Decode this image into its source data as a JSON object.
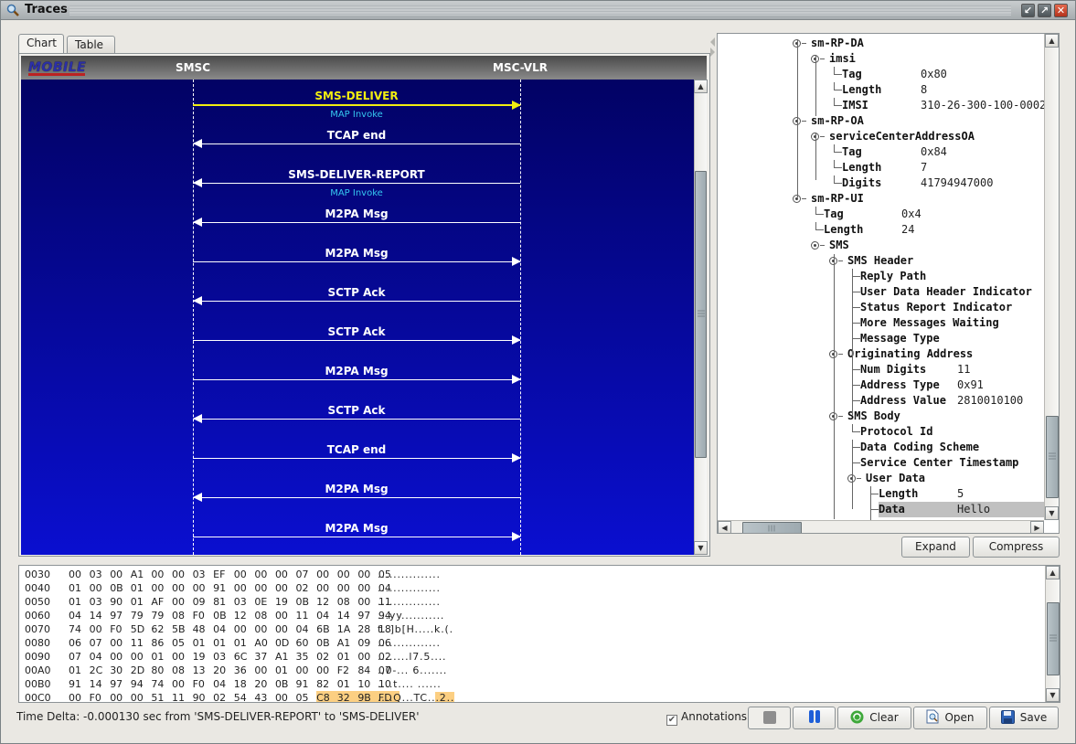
{
  "window": {
    "title": "Traces",
    "controls": [
      "minimize",
      "maximize",
      "close"
    ]
  },
  "tabs": [
    {
      "label": "Chart",
      "active": true
    },
    {
      "label": "Table",
      "active": false
    }
  ],
  "chart": {
    "logo": "MOBILE",
    "entities": [
      "SMSC",
      "MSC-VLR"
    ],
    "messages": [
      {
        "label": "SMS-DELIVER",
        "direction": "right",
        "annotation": "MAP Invoke",
        "highlighted": true
      },
      {
        "label": "TCAP end",
        "direction": "left",
        "annotation": "",
        "highlighted": false
      },
      {
        "label": "SMS-DELIVER-REPORT",
        "direction": "left",
        "annotation": "MAP Invoke",
        "highlighted": false
      },
      {
        "label": "M2PA Msg",
        "direction": "left",
        "annotation": "",
        "highlighted": false
      },
      {
        "label": "M2PA Msg",
        "direction": "right",
        "annotation": "",
        "highlighted": false
      },
      {
        "label": "SCTP Ack",
        "direction": "left",
        "annotation": "",
        "highlighted": false
      },
      {
        "label": "SCTP Ack",
        "direction": "right",
        "annotation": "",
        "highlighted": false
      },
      {
        "label": "M2PA Msg",
        "direction": "right",
        "annotation": "",
        "highlighted": false
      },
      {
        "label": "SCTP Ack",
        "direction": "left",
        "annotation": "",
        "highlighted": false
      },
      {
        "label": "TCAP end",
        "direction": "right",
        "annotation": "",
        "highlighted": false
      },
      {
        "label": "M2PA Msg",
        "direction": "left",
        "annotation": "",
        "highlighted": false
      },
      {
        "label": "M2PA Msg",
        "direction": "right",
        "annotation": "",
        "highlighted": false
      }
    ],
    "colors": {
      "highlight": "#f2ee10",
      "annotation": "#35c8f0",
      "background_top": "#020264",
      "background_bottom": "#0a0fd0"
    }
  },
  "tree": {
    "nodes": [
      {
        "level": 0,
        "label": "sm-RP-DA",
        "value": "",
        "expandable": true
      },
      {
        "level": 1,
        "label": "imsi",
        "value": "",
        "expandable": true
      },
      {
        "level": 2,
        "label": "Tag",
        "value": "0x80"
      },
      {
        "level": 2,
        "label": "Length",
        "value": "8"
      },
      {
        "level": 2,
        "label": "IMSI",
        "value": "310-26-300-100-0002"
      },
      {
        "level": 0,
        "label": "sm-RP-OA",
        "value": "",
        "expandable": true
      },
      {
        "level": 1,
        "label": "serviceCenterAddressOA",
        "value": "",
        "expandable": true
      },
      {
        "level": 2,
        "label": "Tag",
        "value": "0x84"
      },
      {
        "level": 2,
        "label": "Length",
        "value": "7"
      },
      {
        "level": 2,
        "label": "Digits",
        "value": "41794947000"
      },
      {
        "level": 0,
        "label": "sm-RP-UI",
        "value": "",
        "expandable": true
      },
      {
        "level": 1,
        "label": "Tag",
        "value": "0x4"
      },
      {
        "level": 1,
        "label": "Length",
        "value": "24"
      },
      {
        "level": 1,
        "label": "SMS",
        "value": "",
        "expandable": true
      },
      {
        "level": 2,
        "label": "SMS Header",
        "value": "",
        "expandable": true
      },
      {
        "level": 3,
        "label": "Reply Path",
        "value": ""
      },
      {
        "level": 3,
        "label": "User Data Header Indicator",
        "value": ""
      },
      {
        "level": 3,
        "label": "Status Report Indicator",
        "value": ""
      },
      {
        "level": 3,
        "label": "More Messages Waiting",
        "value": ""
      },
      {
        "level": 3,
        "label": "Message Type",
        "value": ""
      },
      {
        "level": 2,
        "label": "Originating Address",
        "value": "",
        "expandable": true
      },
      {
        "level": 3,
        "label": "Num Digits",
        "value": "11"
      },
      {
        "level": 3,
        "label": "Address Type",
        "value": "0x91"
      },
      {
        "level": 3,
        "label": "Address Value",
        "value": "2810010100"
      },
      {
        "level": 2,
        "label": "SMS Body",
        "value": "",
        "expandable": true
      },
      {
        "level": 3,
        "label": "Protocol Id",
        "value": ""
      },
      {
        "level": 3,
        "label": "Data Coding Scheme",
        "value": ""
      },
      {
        "level": 3,
        "label": "Service Center Timestamp",
        "value": ""
      },
      {
        "level": 3,
        "label": "User Data",
        "value": "",
        "expandable": true
      },
      {
        "level": 4,
        "label": "Length",
        "value": "5"
      },
      {
        "level": 4,
        "label": "Data",
        "value": "Hello",
        "selected": true
      }
    ],
    "expand_label": "Expand",
    "compress_label": "Compress"
  },
  "hex": {
    "rows": [
      {
        "offset": "0030",
        "bytes": [
          "00",
          "03",
          "00",
          "A1",
          "00",
          "00",
          "03",
          "EF",
          "00",
          "00",
          "00",
          "07",
          "00",
          "00",
          "00",
          "05"
        ],
        "ascii": "................"
      },
      {
        "offset": "0040",
        "bytes": [
          "01",
          "00",
          "0B",
          "01",
          "00",
          "00",
          "00",
          "91",
          "00",
          "00",
          "00",
          "02",
          "00",
          "00",
          "00",
          "04"
        ],
        "ascii": "................"
      },
      {
        "offset": "0050",
        "bytes": [
          "01",
          "03",
          "90",
          "01",
          "AF",
          "00",
          "09",
          "81",
          "03",
          "0E",
          "19",
          "0B",
          "12",
          "08",
          "00",
          "11"
        ],
        "ascii": "................"
      },
      {
        "offset": "0060",
        "bytes": [
          "04",
          "14",
          "97",
          "79",
          "79",
          "08",
          "F0",
          "0B",
          "12",
          "08",
          "00",
          "11",
          "04",
          "14",
          "97",
          "94"
        ],
        "ascii": "...yy..........."
      },
      {
        "offset": "0070",
        "bytes": [
          "74",
          "00",
          "F0",
          "5D",
          "62",
          "5B",
          "48",
          "04",
          "00",
          "00",
          "00",
          "04",
          "6B",
          "1A",
          "28",
          "18"
        ],
        "ascii": "t..]b[H.....k.(."
      },
      {
        "offset": "0080",
        "bytes": [
          "06",
          "07",
          "00",
          "11",
          "86",
          "05",
          "01",
          "01",
          "01",
          "A0",
          "0D",
          "60",
          "0B",
          "A1",
          "09",
          "06"
        ],
        "ascii": "................"
      },
      {
        "offset": "0090",
        "bytes": [
          "07",
          "04",
          "00",
          "00",
          "01",
          "00",
          "19",
          "03",
          "6C",
          "37",
          "A1",
          "35",
          "02",
          "01",
          "00",
          "02"
        ],
        "ascii": "........l7.5...."
      },
      {
        "offset": "00A0",
        "bytes": [
          "01",
          "2C",
          "30",
          "2D",
          "80",
          "08",
          "13",
          "20",
          "36",
          "00",
          "01",
          "00",
          "00",
          "F2",
          "84",
          "07"
        ],
        "ascii": ".,0-... 6......."
      },
      {
        "offset": "00B0",
        "bytes": [
          "91",
          "14",
          "97",
          "94",
          "74",
          "00",
          "F0",
          "04",
          "18",
          "20",
          "0B",
          "91",
          "82",
          "01",
          "10",
          "10"
        ],
        "ascii": "....t.... ......"
      },
      {
        "offset": "00C0",
        "bytes": [
          "00",
          "F0",
          "00",
          "00",
          "51",
          "11",
          "90",
          "02",
          "54",
          "43",
          "00",
          "05",
          "C8",
          "32",
          "9B",
          "FD"
        ],
        "ascii": "....Q...TC...2..",
        "highlight_from": 12
      }
    ],
    "highlight_color": "#fccf82"
  },
  "status": {
    "time_delta": "Time Delta: -0.000130 sec from 'SMS-DELIVER-REPORT' to 'SMS-DELIVER'"
  },
  "toolbar": {
    "annotations_label": "Annotations",
    "annotations_checked": true,
    "stop_icon": "stop-icon",
    "pause_icon": "pause-icon",
    "clear_label": "Clear",
    "open_label": "Open",
    "save_label": "Save"
  }
}
